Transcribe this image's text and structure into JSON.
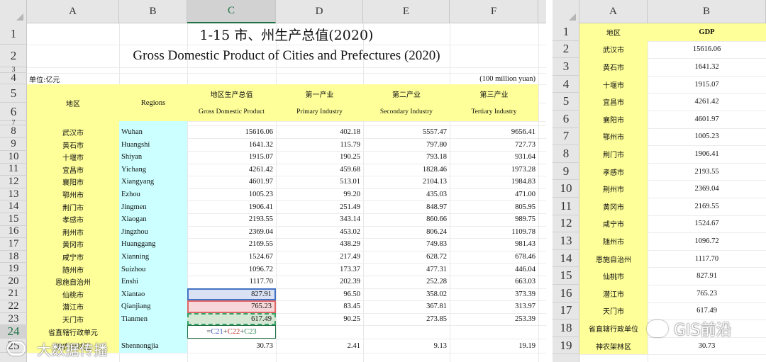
{
  "left_sheet": {
    "columns": [
      "A",
      "B",
      "C",
      "D",
      "E",
      "F"
    ],
    "active_column": "C",
    "row_numbers": [
      "1",
      "2",
      "3",
      "4",
      "5",
      "6",
      "7",
      "8",
      "9",
      "10",
      "11",
      "12",
      "13",
      "14",
      "15",
      "16",
      "17",
      "18",
      "19",
      "20",
      "21",
      "22",
      "23",
      "24",
      "25"
    ],
    "title_zh": "1-15  市、州生产总值(2020)",
    "title_en": "Gross Domestic Product of Cities and Prefectures (2020)",
    "unit_zh": "单位:亿元",
    "unit_en": "(100 million yuan)",
    "header": {
      "region_zh": "地区",
      "region_en": "Regions",
      "gdp_zh": "地区生产总值",
      "gdp_en": "Gross Domestic Product",
      "primary_zh": "第一产业",
      "primary_en": "Primary Industry",
      "secondary_zh": "第二产业",
      "secondary_en": "Secondary Industry",
      "tertiary_zh": "第三产业",
      "tertiary_en": "Tertiary Industry"
    },
    "rows": [
      {
        "zh": "武汉市",
        "en": "Wuhan",
        "gdp": "15616.06",
        "p1": "402.18",
        "p2": "5557.47",
        "p3": "9656.41"
      },
      {
        "zh": "黄石市",
        "en": "Huangshi",
        "gdp": "1641.32",
        "p1": "115.79",
        "p2": "797.80",
        "p3": "727.73"
      },
      {
        "zh": "十堰市",
        "en": "Shiyan",
        "gdp": "1915.07",
        "p1": "190.25",
        "p2": "793.18",
        "p3": "931.64"
      },
      {
        "zh": "宜昌市",
        "en": "Yichang",
        "gdp": "4261.42",
        "p1": "459.68",
        "p2": "1828.46",
        "p3": "1973.28"
      },
      {
        "zh": "襄阳市",
        "en": "Xiangyang",
        "gdp": "4601.97",
        "p1": "513.01",
        "p2": "2104.13",
        "p3": "1984.83"
      },
      {
        "zh": "鄂州市",
        "en": "Ezhou",
        "gdp": "1005.23",
        "p1": "99.20",
        "p2": "435.03",
        "p3": "471.00"
      },
      {
        "zh": "荆门市",
        "en": "Jingmen",
        "gdp": "1906.41",
        "p1": "251.49",
        "p2": "848.97",
        "p3": "805.95"
      },
      {
        "zh": "孝感市",
        "en": "Xiaogan",
        "gdp": "2193.55",
        "p1": "343.14",
        "p2": "860.66",
        "p3": "989.75"
      },
      {
        "zh": "荆州市",
        "en": "Jingzhou",
        "gdp": "2369.04",
        "p1": "453.02",
        "p2": "806.24",
        "p3": "1109.78"
      },
      {
        "zh": "黄冈市",
        "en": "Huanggang",
        "gdp": "2169.55",
        "p1": "438.29",
        "p2": "749.83",
        "p3": "981.43"
      },
      {
        "zh": "咸宁市",
        "en": "Xianning",
        "gdp": "1524.67",
        "p1": "217.49",
        "p2": "628.72",
        "p3": "678.46"
      },
      {
        "zh": "随州市",
        "en": "Suizhou",
        "gdp": "1096.72",
        "p1": "173.37",
        "p2": "477.31",
        "p3": "446.04"
      },
      {
        "zh": "恩施自治州",
        "en": "Enshi",
        "gdp": "1117.70",
        "p1": "202.39",
        "p2": "252.28",
        "p3": "663.03"
      },
      {
        "zh": "仙桃市",
        "en": "Xiantao",
        "gdp": "827.91",
        "p1": "96.50",
        "p2": "358.02",
        "p3": "373.39"
      },
      {
        "zh": "潜江市",
        "en": "Qianjiang",
        "gdp": "765.23",
        "p1": "83.45",
        "p2": "367.81",
        "p3": "313.97"
      },
      {
        "zh": "天门市",
        "en": "Tianmen",
        "gdp": "617.49",
        "p1": "90.25",
        "p2": "273.85",
        "p3": "253.39"
      }
    ],
    "row_24_zh": "省直辖行政单元",
    "row_25": {
      "zh": "神农架林区",
      "en": "Shennongjia",
      "gdp": "30.73",
      "p1": "2.41",
      "p2": "9.13",
      "p3": "19.19"
    },
    "formula": {
      "eq": "=",
      "c21": "C21",
      "plus": "+",
      "c22": "C22",
      "c23": "C23"
    }
  },
  "right_sheet": {
    "columns": [
      "A",
      "B"
    ],
    "header_region": "地区",
    "header_gdp": "GDP",
    "rows": [
      {
        "zh": "武汉市",
        "gdp": "15616.06"
      },
      {
        "zh": "黄石市",
        "gdp": "1641.32"
      },
      {
        "zh": "十堰市",
        "gdp": "1915.07"
      },
      {
        "zh": "宜昌市",
        "gdp": "4261.42"
      },
      {
        "zh": "襄阳市",
        "gdp": "4601.97"
      },
      {
        "zh": "鄂州市",
        "gdp": "1005.23"
      },
      {
        "zh": "荆门市",
        "gdp": "1906.41"
      },
      {
        "zh": "孝感市",
        "gdp": "2193.55"
      },
      {
        "zh": "荆州市",
        "gdp": "2369.04"
      },
      {
        "zh": "黄冈市",
        "gdp": "2169.55"
      },
      {
        "zh": "咸宁市",
        "gdp": "1524.67"
      },
      {
        "zh": "随州市",
        "gdp": "1096.72"
      },
      {
        "zh": "恩施自治州",
        "gdp": "1117.70"
      },
      {
        "zh": "仙桃市",
        "gdp": "827.91"
      },
      {
        "zh": "潜江市",
        "gdp": "765.23"
      },
      {
        "zh": "天门市",
        "gdp": "617.49"
      },
      {
        "zh": "省直辖行政单位",
        "gdp": ""
      },
      {
        "zh": "神农架林区",
        "gdp": "30.73"
      }
    ]
  },
  "watermarks": {
    "left_text": "大数据传播",
    "right_text": "GIS前沿"
  },
  "colors": {
    "yellow_fill": "#ffff99",
    "cyan_fill": "#ccffff",
    "excel_green": "#217346"
  }
}
